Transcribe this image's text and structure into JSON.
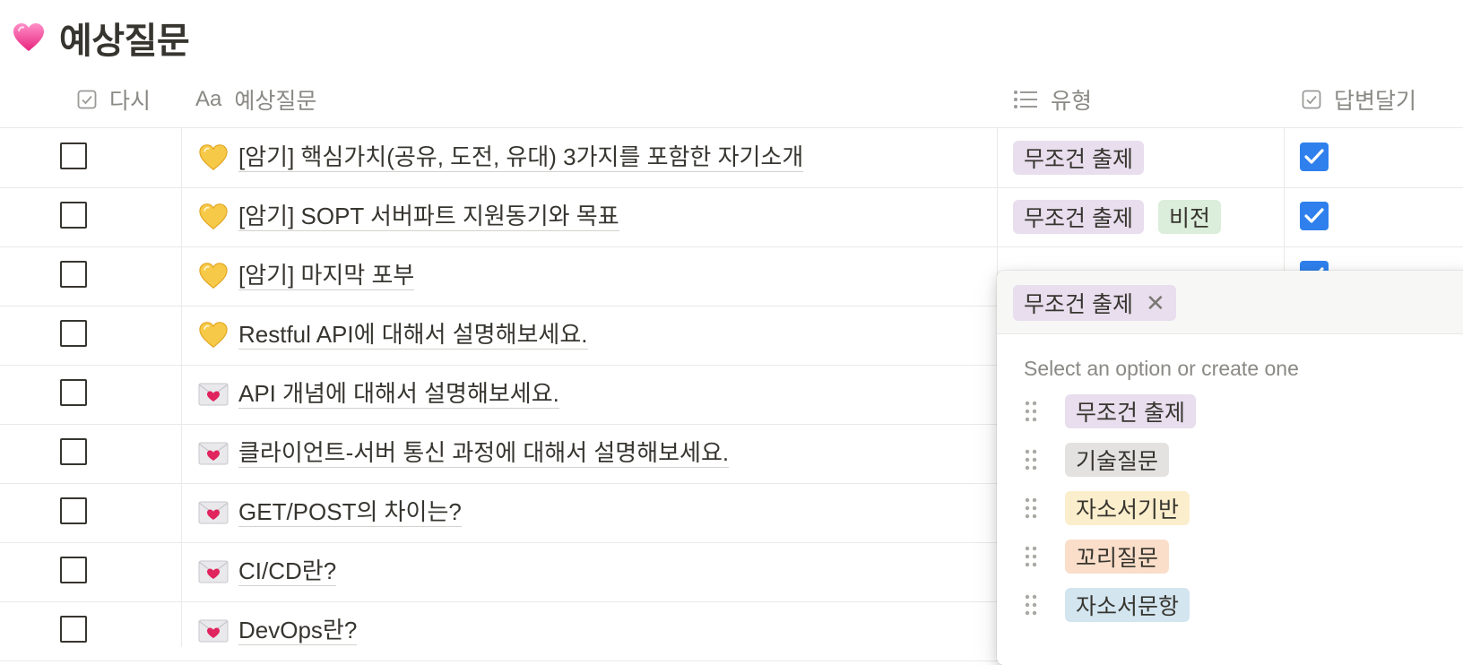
{
  "page": {
    "title": "예상질문"
  },
  "columns": {
    "check": "다시",
    "title_icon": "Aa",
    "title": "예상질문",
    "type": "유형",
    "answer": "답변달기"
  },
  "colors": {
    "tag_mandatory": "#e8deee",
    "tag_vision": "#dbeddb",
    "tag_tech": "#e3e2e0",
    "tag_essay": "#fbeecc",
    "tag_followup": "#fadec9",
    "tag_essayq": "#d3e5ef",
    "checked_blue": "#2f80ed"
  },
  "rows": [
    {
      "emoji": "yellow-heart",
      "title": "[암기] 핵심가치(공유, 도전, 유대) 3가지를 포함한 자기소개",
      "checked": false,
      "tags": [
        "무조건 출제"
      ],
      "answered": true
    },
    {
      "emoji": "yellow-heart",
      "title": "[암기] SOPT 서버파트 지원동기와 목표",
      "checked": false,
      "tags": [
        "무조건 출제",
        "비전"
      ],
      "answered": true
    },
    {
      "emoji": "yellow-heart",
      "title": "[암기] 마지막 포부",
      "checked": false,
      "tags": [],
      "answered": true
    },
    {
      "emoji": "yellow-heart",
      "title": "Restful API에 대해서 설명해보세요.",
      "checked": false,
      "tags": [],
      "answered": false
    },
    {
      "emoji": "love-letter",
      "title": "API 개념에 대해서 설명해보세요.",
      "checked": false,
      "tags": [],
      "answered": false
    },
    {
      "emoji": "love-letter",
      "title": "클라이언트-서버 통신 과정에 대해서 설명해보세요.",
      "checked": false,
      "tags": [],
      "answered": false
    },
    {
      "emoji": "love-letter",
      "title": "GET/POST의 차이는?",
      "checked": false,
      "tags": [],
      "answered": false
    },
    {
      "emoji": "love-letter",
      "title": "CI/CD란?",
      "checked": false,
      "tags": [],
      "answered": false
    },
    {
      "emoji": "love-letter",
      "title": "DevOps란?",
      "checked": false,
      "tags": [],
      "answered": false
    }
  ],
  "popup": {
    "selected": "무조건 출제",
    "hint": "Select an option or create one",
    "options": [
      "무조건 출제",
      "기술질문",
      "자소서기반",
      "꼬리질문",
      "자소서문항"
    ]
  }
}
